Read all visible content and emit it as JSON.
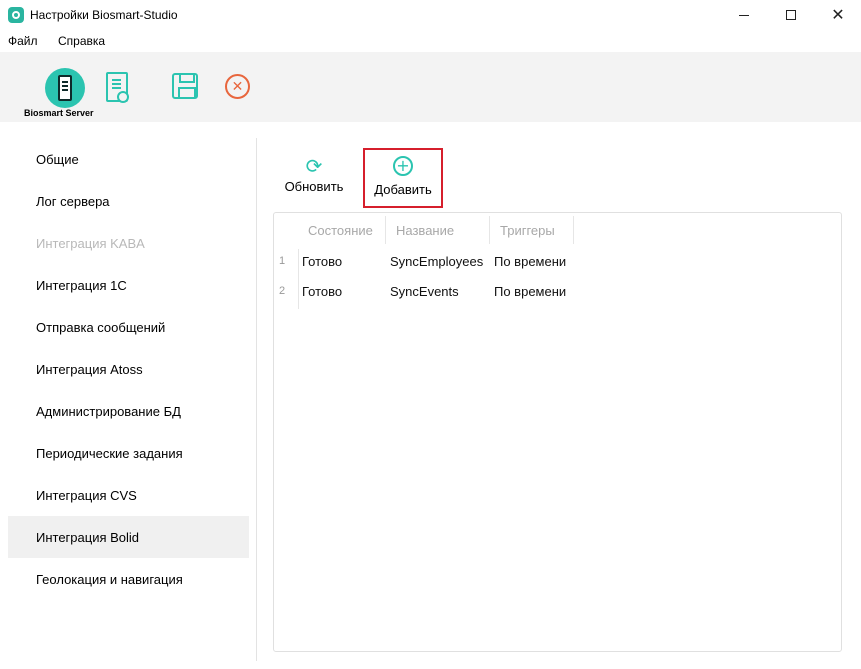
{
  "window": {
    "title": "Настройки Biosmart-Studio",
    "controls": {
      "minimize": "—",
      "maximize": "☐",
      "close": "✕"
    }
  },
  "menu": {
    "file": "Файл",
    "help": "Справка"
  },
  "toolbar": {
    "server_label": "Biosmart Server",
    "icons": [
      "server-icon",
      "certificate-icon",
      "save-icon",
      "cancel-icon"
    ],
    "accent_color": "#2bc4b0",
    "cancel_color": "#e8663d",
    "cancel_glyph": "✕"
  },
  "sidebar": {
    "items": [
      {
        "label": "Общие",
        "state": "normal"
      },
      {
        "label": "Лог сервера",
        "state": "normal"
      },
      {
        "label": "Интеграция KABA",
        "state": "disabled"
      },
      {
        "label": "Интеграция 1С",
        "state": "normal"
      },
      {
        "label": "Отправка сообщений",
        "state": "normal"
      },
      {
        "label": "Интеграция Atoss",
        "state": "normal"
      },
      {
        "label": "Администрирование БД",
        "state": "normal"
      },
      {
        "label": "Периодические задания",
        "state": "normal"
      },
      {
        "label": "Интеграция CVS",
        "state": "normal"
      },
      {
        "label": "Интеграция Bolid",
        "state": "selected"
      },
      {
        "label": "Геолокация и навигация",
        "state": "normal"
      }
    ]
  },
  "actions": {
    "refresh_label": "Обновить",
    "refresh_glyph": "⟳",
    "add_label": "Добавить",
    "add_glyph": "+",
    "highlight_color": "#d61f2c"
  },
  "table": {
    "columns": [
      "Состояние",
      "Название",
      "Триггеры"
    ],
    "rows": [
      {
        "num": "1",
        "state": "Готово",
        "name": "SyncEmployees",
        "trigger": "По времени"
      },
      {
        "num": "2",
        "state": "Готово",
        "name": "SyncEvents",
        "trigger": "По времени"
      }
    ]
  }
}
